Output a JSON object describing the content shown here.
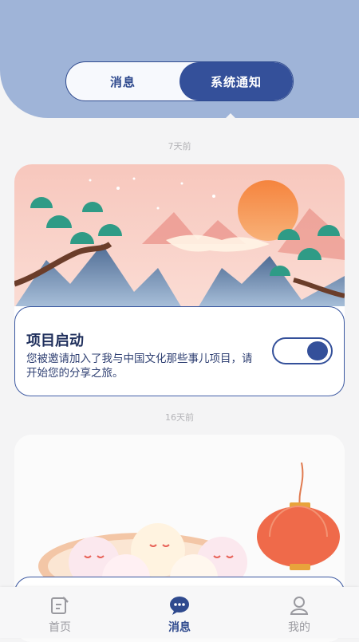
{
  "tabs": {
    "messages": "消息",
    "system_notice": "系统通知",
    "active": "system_notice"
  },
  "feed": [
    {
      "time": "7天前",
      "title": "项目启动",
      "description": "您被邀请加入了我与中国文化那些事儿项目，请开始您的分享之旅。",
      "toggle_on": true
    },
    {
      "time": "16天前"
    }
  ],
  "bottom_nav": {
    "items": [
      {
        "label": "首页",
        "icon": "edit-icon"
      },
      {
        "label": "消息",
        "icon": "chat-bubble-icon"
      },
      {
        "label": "我的",
        "icon": "user-icon"
      }
    ],
    "active_index": 1
  },
  "colors": {
    "header": "#9fb4d8",
    "primary": "#34509a",
    "text_dark": "#1f2f5c"
  }
}
